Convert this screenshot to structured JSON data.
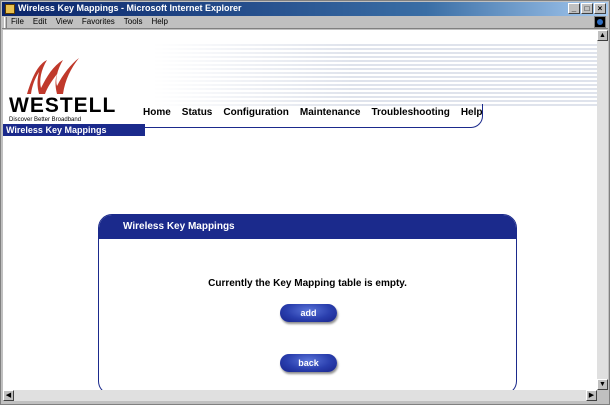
{
  "window": {
    "title": "Wireless Key Mappings - Microsoft Internet Explorer",
    "controls": [
      "_",
      "□",
      "×"
    ]
  },
  "menubar": {
    "items": [
      "File",
      "Edit",
      "View",
      "Favorites",
      "Tools",
      "Help"
    ]
  },
  "header": {
    "brand": "WESTELL",
    "tagline": "Discover Better Broadband",
    "nav": [
      "Home",
      "Status",
      "Configuration",
      "Maintenance",
      "Troubleshooting",
      "Help"
    ]
  },
  "page": {
    "title": "Wireless Key Mappings"
  },
  "panel": {
    "title": "Wireless Key Mappings",
    "message": "Currently the Key Mapping table is empty.",
    "add_label": "add",
    "back_label": "back"
  },
  "colors": {
    "brand_blue": "#1b2a8c",
    "logo_red": "#c0392b"
  },
  "icons": {
    "app": "ie-icon",
    "throbber": "windows-logo-icon",
    "logo": "westell-w-logo"
  }
}
